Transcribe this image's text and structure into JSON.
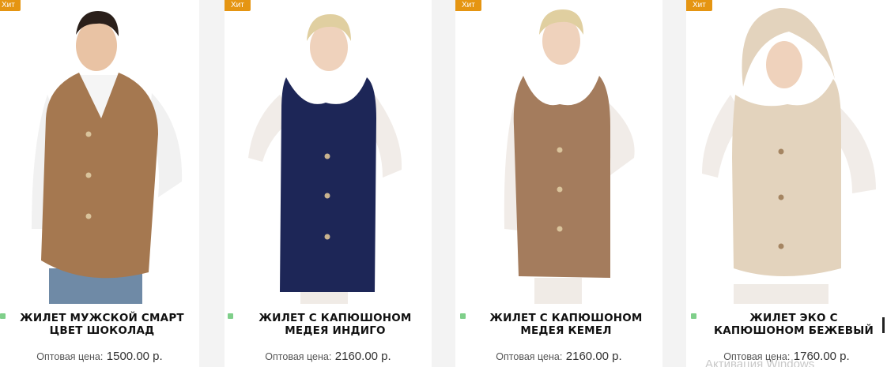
{
  "products": [
    {
      "badge": "Хит",
      "title": "ЖИЛЕТ МУЖСКОЙ СМАРТ ЦВЕТ ШОКОЛАД",
      "price_label": "Оптовая цена:",
      "price": "1500.00 р.",
      "image": "man-brown-sheepskin-vest-photo",
      "vest_color": "#a57850",
      "stock_indicator_color": "#7fcf8a"
    },
    {
      "badge": "Хит",
      "title": "ЖИЛЕТ С КАПЮШОНОМ МЕДЕЯ ИНДИГО",
      "price_label": "Оптовая цена:",
      "price": "2160.00 р.",
      "image": "woman-navy-hooded-vest-photo",
      "vest_color": "#1d2657",
      "stock_indicator_color": "#7fcf8a"
    },
    {
      "badge": "Хит",
      "title": "ЖИЛЕТ С КАПЮШОНОМ МЕДЕЯ КЕМЕЛ",
      "price_label": "Оптовая цена:",
      "price": "2160.00 р.",
      "image": "woman-camel-hooded-vest-photo",
      "vest_color": "#a47c5d",
      "stock_indicator_color": "#7fcf8a"
    },
    {
      "badge": "Хит",
      "title": "ЖИЛЕТ ЭКО С КАПЮШОНОМ БЕЖЕВЫЙ",
      "price_label": "Оптовая цена:",
      "price": "1760.00 р.",
      "image": "woman-beige-hooded-vest-photo",
      "vest_color": "#e3d3bd",
      "stock_indicator_color": "#7fcf8a"
    }
  ],
  "watermark": "Активация Windows"
}
